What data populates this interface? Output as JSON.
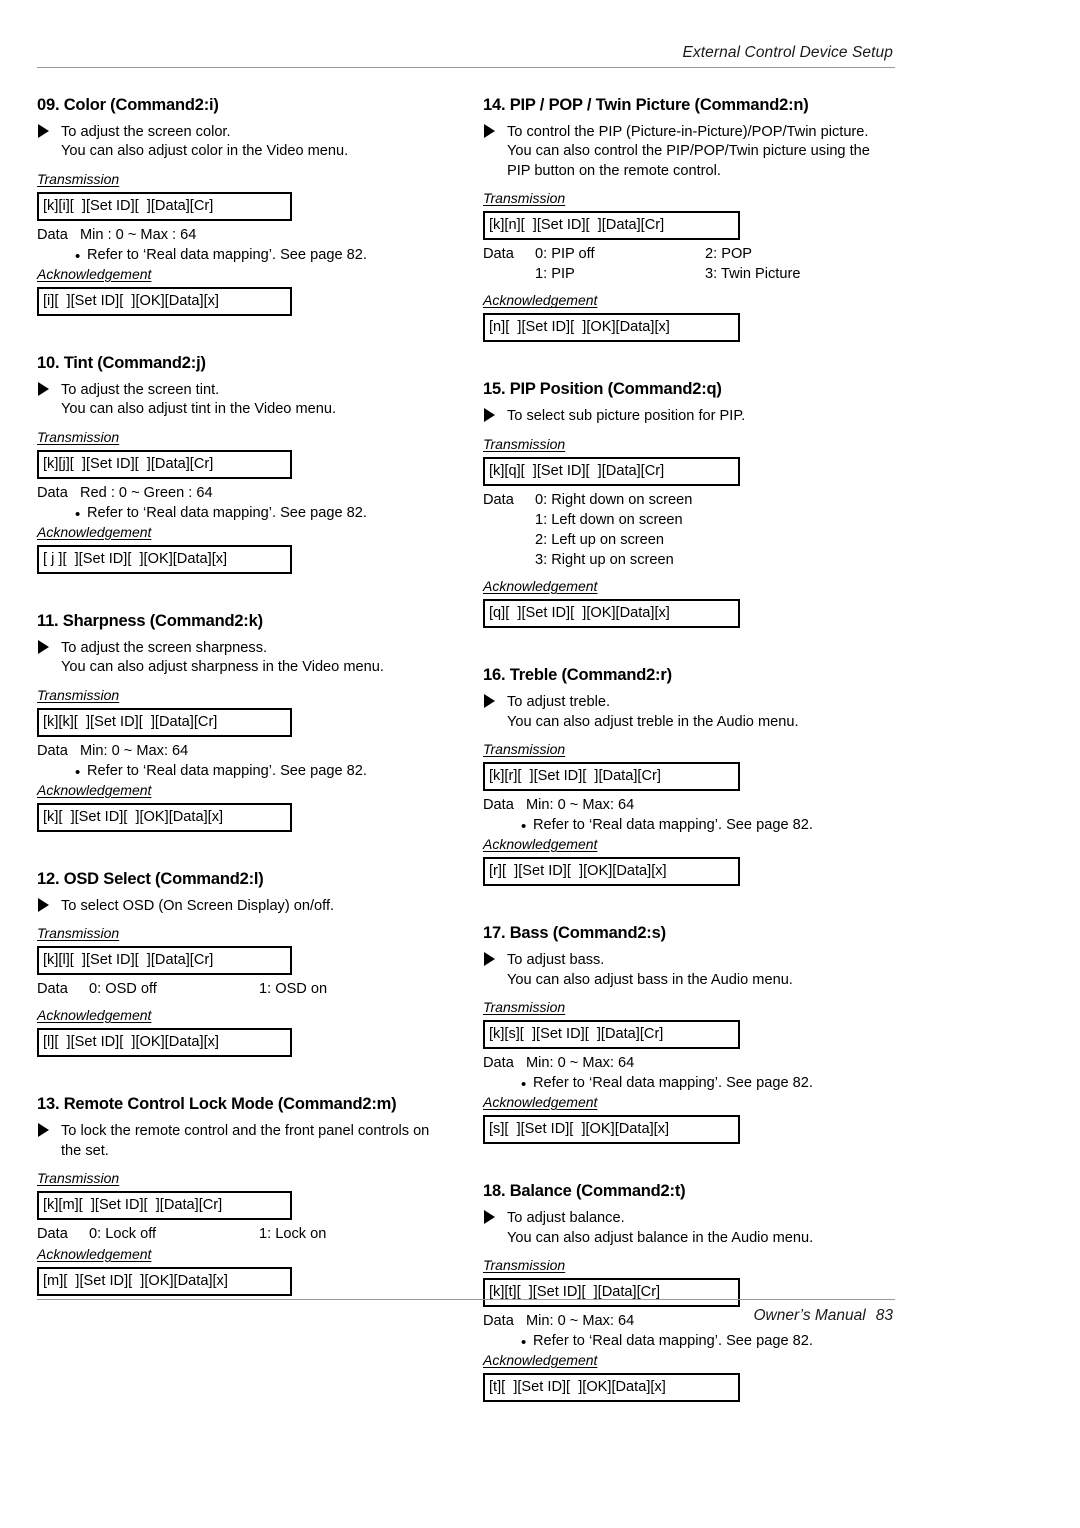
{
  "header": {
    "title": "External Control Device Setup"
  },
  "footer": {
    "manual_label": "Owner’s Manual",
    "page_number": "83"
  },
  "labels": {
    "transmission": "Transmission",
    "acknowledgement": "Acknowledgement",
    "data": "Data",
    "bullet": "•",
    "note_ref": "Refer to ‘Real data mapping’. See page 82."
  },
  "left_column": [
    {
      "id": "color",
      "title": "09. Color (Command2:i)",
      "desc_line1": "To adjust the screen color.",
      "desc_line2": "You can also adjust color in the Video menu.",
      "transmission": "[k][i][  ][Set ID][  ][Data][Cr]",
      "data_label": "Data",
      "data_value": "Min : 0 ~ Max : 64",
      "note": "Refer to ‘Real data mapping’. See page 82.",
      "acknowledgement": "[i][  ][Set ID][  ][OK][Data][x]"
    },
    {
      "id": "tint",
      "title": "10. Tint (Command2:j)",
      "desc_line1": "To adjust the screen tint.",
      "desc_line2": "You can also adjust tint in the Video menu.",
      "transmission": "[k][j][  ][Set ID][  ][Data][Cr]",
      "data_label": "Data",
      "data_value": "Red : 0 ~ Green : 64",
      "note": "Refer to ‘Real data mapping’. See page 82.",
      "acknowledgement": "[ j ][  ][Set ID][  ][OK][Data][x]"
    },
    {
      "id": "sharpness",
      "title": "11. Sharpness (Command2:k)",
      "desc_line1": "To adjust the screen sharpness.",
      "desc_line2": "You can also adjust sharpness in the Video menu.",
      "transmission": "[k][k][  ][Set ID][  ][Data][Cr]",
      "data_label": "Data",
      "data_value": "Min: 0 ~ Max: 64",
      "note": "Refer to ‘Real data mapping’. See page 82.",
      "acknowledgement": "[k][  ][Set ID][  ][OK][Data][x]"
    },
    {
      "id": "osd-select",
      "title": "12. OSD Select (Command2:l)",
      "desc_line1": "To select OSD (On Screen Display) on/off.",
      "transmission": "[k][l][  ][Set ID][  ][Data][Cr]",
      "data_label": "Data",
      "data_col1": "0: OSD off",
      "data_col2": "1: OSD on",
      "acknowledgement": "[l][  ][Set ID][  ][OK][Data][x]"
    },
    {
      "id": "remote-control-lock-mode",
      "title": "13. Remote Control Lock Mode (Command2:m)",
      "desc_line1": "To lock the remote control and the front panel controls on",
      "desc_line2": "the set.",
      "transmission": "[k][m][  ][Set ID][  ][Data][Cr]",
      "data_label": "Data",
      "data_col1": "0: Lock off",
      "data_col2": "1: Lock on",
      "acknowledgement": "[m][  ][Set ID][  ][OK][Data][x]"
    }
  ],
  "right_column": [
    {
      "id": "pip-pop-twin-picture",
      "title": "14. PIP / POP / Twin Picture (Command2:n)",
      "desc_line1": "To control the PIP (Picture-in-Picture)/POP/Twin picture.",
      "desc_line2": "You can also control the PIP/POP/Twin picture using the",
      "desc_line3": "PIP button on the remote control.",
      "transmission": "[k][n][  ][Set ID][  ][Data][Cr]",
      "data_label": "Data",
      "data_rows": [
        {
          "c1": "0: PIP off",
          "c2": "2: POP"
        },
        {
          "c1": "1: PIP",
          "c2": "3: Twin Picture"
        }
      ],
      "acknowledgement": "[n][  ][Set ID][  ][OK][Data][x]"
    },
    {
      "id": "pip-position",
      "title": "15. PIP Position (Command2:q)",
      "desc_line1": "To select sub picture position for PIP.",
      "transmission": "[k][q][  ][Set ID][  ][Data][Cr]",
      "data_label": "Data",
      "data_items": [
        "0: Right down on screen",
        "1: Left down on screen",
        "2: Left up on screen",
        "3: Right up on screen"
      ],
      "acknowledgement": "[q][  ][Set ID][  ][OK][Data][x]"
    },
    {
      "id": "treble",
      "title": "16. Treble (Command2:r)",
      "desc_line1": "To adjust treble.",
      "desc_line2": "You can also adjust treble in the Audio menu.",
      "transmission": "[k][r][  ][Set ID][  ][Data][Cr]",
      "data_label": "Data",
      "data_value": "Min: 0 ~ Max: 64",
      "note": "Refer to ‘Real data mapping’. See page 82.",
      "acknowledgement": "[r][  ][Set ID][  ][OK][Data][x]"
    },
    {
      "id": "bass",
      "title": "17. Bass (Command2:s)",
      "desc_line1": "To adjust bass.",
      "desc_line2": "You can also adjust bass in the Audio menu.",
      "transmission": "[k][s][  ][Set ID][  ][Data][Cr]",
      "data_label": "Data",
      "data_value": "Min: 0 ~ Max: 64",
      "note": "Refer to ‘Real data mapping’. See page 82.",
      "acknowledgement": "[s][  ][Set ID][  ][OK][Data][x]"
    },
    {
      "id": "balance",
      "title": "18. Balance (Command2:t)",
      "desc_line1": "To adjust balance.",
      "desc_line2": "You can also adjust balance in the Audio menu.",
      "transmission": "[k][t][  ][Set ID][  ][Data][Cr]",
      "data_label": "Data",
      "data_value": "Min: 0 ~ Max: 64",
      "note": "Refer to ‘Real data mapping’. See page 82.",
      "acknowledgement": "[t][  ][Set ID][  ][OK][Data][x]"
    }
  ]
}
